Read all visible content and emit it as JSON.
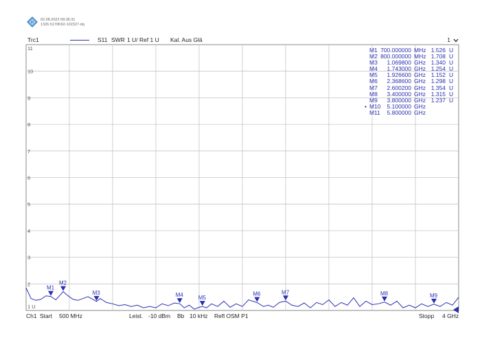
{
  "header": {
    "logo": "rohde-schwarz-logo",
    "timestamp": "02.08.2022 09:36:31",
    "instrument_id": "1326.5170K92-102327-dq"
  },
  "trace_bar": {
    "trace": "Trc1",
    "param": "S11",
    "format": "SWR",
    "scale": "1 U/ Ref 1 U",
    "cal": "Kal. Aus Glä",
    "channel_number": "1",
    "menu_icon": "chevron-down-icon",
    "trace_color": "#2a2fb0"
  },
  "y_axis": {
    "labels": [
      "11",
      "10",
      "9",
      "8",
      "7",
      "6",
      "5",
      "4",
      "3",
      "2",
      "1 U"
    ],
    "min": 1,
    "max": 11
  },
  "markers": [
    {
      "name": "M1",
      "value": "700.000000",
      "unit": "MHz",
      "result": "1.526",
      "result_unit": "U",
      "freq_ghz": 0.7,
      "swr": 1.526,
      "active": false
    },
    {
      "name": "M2",
      "value": "800.000000",
      "unit": "MHz",
      "result": "1.708",
      "result_unit": "U",
      "freq_ghz": 0.8,
      "swr": 1.708,
      "active": false
    },
    {
      "name": "M3",
      "value": "1.069800",
      "unit": "GHz",
      "result": "1.340",
      "result_unit": "U",
      "freq_ghz": 1.0698,
      "swr": 1.34,
      "active": false
    },
    {
      "name": "M4",
      "value": "1.743000",
      "unit": "GHz",
      "result": "1.254",
      "result_unit": "U",
      "freq_ghz": 1.743,
      "swr": 1.254,
      "active": false
    },
    {
      "name": "M5",
      "value": "1.926600",
      "unit": "GHz",
      "result": "1.152",
      "result_unit": "U",
      "freq_ghz": 1.9266,
      "swr": 1.152,
      "active": false
    },
    {
      "name": "M6",
      "value": "2.368600",
      "unit": "GHz",
      "result": "1.298",
      "result_unit": "U",
      "freq_ghz": 2.3686,
      "swr": 1.298,
      "active": false
    },
    {
      "name": "M7",
      "value": "2.600200",
      "unit": "GHz",
      "result": "1.354",
      "result_unit": "U",
      "freq_ghz": 2.6002,
      "swr": 1.354,
      "active": false
    },
    {
      "name": "M8",
      "value": "3.400000",
      "unit": "GHz",
      "result": "1.315",
      "result_unit": "U",
      "freq_ghz": 3.4,
      "swr": 1.315,
      "active": false
    },
    {
      "name": "M9",
      "value": "3.800000",
      "unit": "GHz",
      "result": "1.237",
      "result_unit": "U",
      "freq_ghz": 3.8,
      "swr": 1.237,
      "active": false
    },
    {
      "name": "M10",
      "value": "5.100000",
      "unit": "GHz",
      "result": "",
      "result_unit": "",
      "freq_ghz": 5.1,
      "swr": 1.45,
      "active": true
    },
    {
      "name": "M11",
      "value": "5.800000",
      "unit": "GHz",
      "result": "",
      "result_unit": "",
      "freq_ghz": 5.8,
      "swr": 1.3,
      "active": false
    }
  ],
  "footer": {
    "channel": "Ch1",
    "start_label": "Start",
    "start": "500 MHz",
    "power_label": "Leist.",
    "power": "-10 dBm",
    "bw_label": "Bb",
    "bw": "10 kHz",
    "port": "Refl OSM P1",
    "stop_label": "Stopp",
    "stop": "4 GHz"
  },
  "chart_data": {
    "type": "line",
    "x_range_ghz": [
      0.5,
      4.0
    ],
    "ylim": [
      1,
      11
    ],
    "grid": true,
    "series": [
      {
        "x": [
          0.5,
          0.54,
          0.58,
          0.62,
          0.66,
          0.7,
          0.74,
          0.77,
          0.8,
          0.84,
          0.88,
          0.92,
          0.96,
          1.0,
          1.04,
          1.0698,
          1.1,
          1.15,
          1.2,
          1.25,
          1.3,
          1.35,
          1.4,
          1.45,
          1.5,
          1.55,
          1.6,
          1.65,
          1.7,
          1.743,
          1.78,
          1.82,
          1.86,
          1.9,
          1.9266,
          1.96,
          2.0,
          2.05,
          2.1,
          2.15,
          2.2,
          2.25,
          2.3,
          2.3686,
          2.42,
          2.46,
          2.5,
          2.55,
          2.6002,
          2.65,
          2.7,
          2.75,
          2.8,
          2.85,
          2.9,
          2.95,
          3.0,
          3.05,
          3.1,
          3.15,
          3.2,
          3.25,
          3.3,
          3.35,
          3.4,
          3.45,
          3.5,
          3.55,
          3.6,
          3.65,
          3.7,
          3.75,
          3.8,
          3.85,
          3.9,
          3.95,
          4.0
        ],
        "y": [
          1.85,
          1.45,
          1.38,
          1.42,
          1.55,
          1.526,
          1.4,
          1.55,
          1.708,
          1.55,
          1.42,
          1.38,
          1.45,
          1.52,
          1.42,
          1.34,
          1.45,
          1.3,
          1.25,
          1.18,
          1.22,
          1.15,
          1.2,
          1.1,
          1.15,
          1.1,
          1.25,
          1.18,
          1.28,
          1.254,
          1.1,
          1.2,
          1.05,
          1.12,
          1.152,
          1.1,
          1.25,
          1.15,
          1.35,
          1.12,
          1.25,
          1.15,
          1.4,
          1.298,
          1.15,
          1.2,
          1.12,
          1.3,
          1.354,
          1.2,
          1.15,
          1.28,
          1.1,
          1.3,
          1.22,
          1.4,
          1.15,
          1.3,
          1.2,
          1.48,
          1.15,
          1.35,
          1.22,
          1.25,
          1.315,
          1.2,
          1.35,
          1.1,
          1.2,
          1.1,
          1.25,
          1.15,
          1.237,
          1.15,
          1.3,
          1.2,
          1.5
        ]
      }
    ]
  }
}
